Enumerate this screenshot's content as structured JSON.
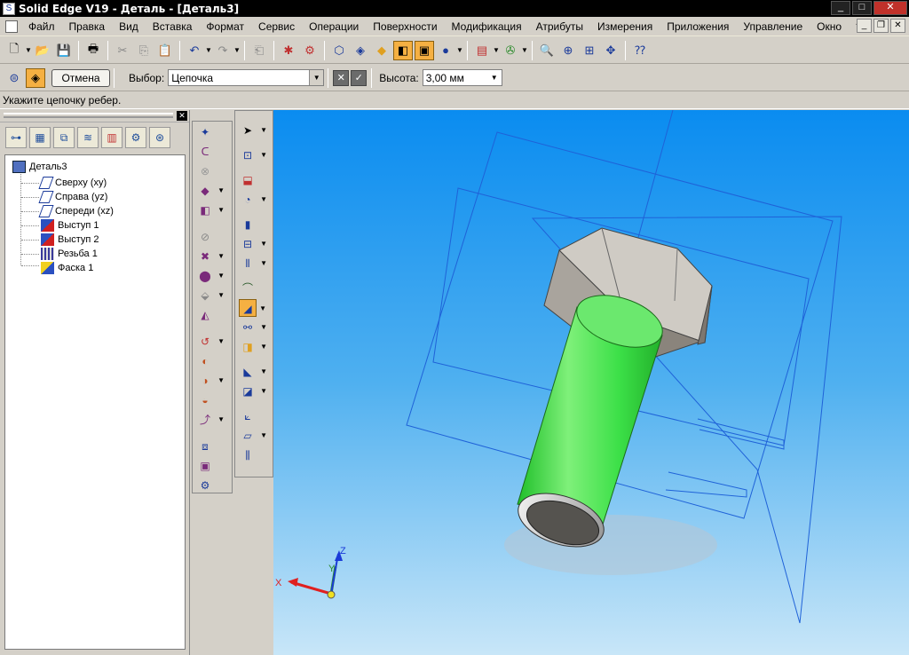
{
  "window": {
    "title": "Solid Edge V19 - Деталь - [Деталь3]",
    "minimize": "_",
    "maximize": "□",
    "close": "✕"
  },
  "menu": [
    "Файл",
    "Правка",
    "Вид",
    "Вставка",
    "Формат",
    "Сервис",
    "Операции",
    "Поверхности",
    "Модификация",
    "Атрибуты",
    "Измерения",
    "Приложения",
    "Управление",
    "Окно",
    "?"
  ],
  "command_bar": {
    "cancel_label": "Отмена",
    "select_label": "Выбор:",
    "select_value": "Цепочка",
    "height_label": "Высота:",
    "height_value": "3,00 мм"
  },
  "prompt": "Укажите цепочку ребер.",
  "tree": {
    "root": "Деталь3",
    "items": [
      "Сверху (xy)",
      "Справа (yz)",
      "Спереди (xz)",
      "Выступ 1",
      "Выступ 2",
      "Резьба 1",
      "Фаска 1"
    ]
  },
  "triad": {
    "x": "X",
    "y": "Y",
    "z": "Z"
  },
  "colors": {
    "viewport_top": "#0a8cf0",
    "bolt_shank": "#3ce048",
    "bolt_head": "#cfcbc4",
    "plane_lines": "#1f62d8",
    "active_tool": "#f5b042"
  }
}
